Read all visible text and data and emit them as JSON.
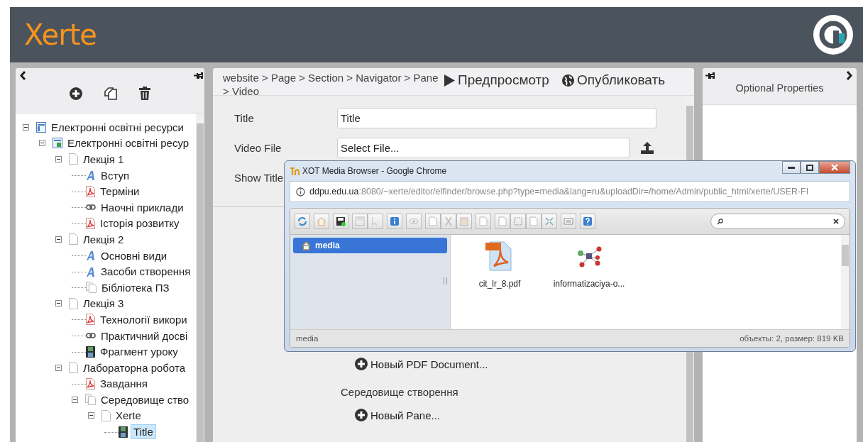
{
  "header": {
    "logo": "Xerte"
  },
  "tree_panel": {
    "tree": [
      {
        "label": "Електронні освітні ресурси",
        "kind": "root",
        "selected": false,
        "children": [
          {
            "label": "Електронні освітні ресур",
            "kind": "site",
            "selected": false,
            "children": [
              {
                "label": "Лекція 1",
                "kind": "page",
                "selected": false,
                "children": [
                  {
                    "label": "Вступ",
                    "kind": "text",
                    "selected": false
                  },
                  {
                    "label": "Терміни",
                    "kind": "pdf",
                    "selected": false
                  },
                  {
                    "label": "Наочні приклади",
                    "kind": "link",
                    "selected": false
                  },
                  {
                    "label": "Історія розвитку",
                    "kind": "pdf",
                    "selected": false
                  }
                ]
              },
              {
                "label": "Лекція 2",
                "kind": "page",
                "selected": false,
                "children": [
                  {
                    "label": "Основні види",
                    "kind": "text",
                    "selected": false
                  },
                  {
                    "label": "Засоби створення",
                    "kind": "text",
                    "selected": false
                  },
                  {
                    "label": "Бібліотека ПЗ",
                    "kind": "group",
                    "selected": false
                  }
                ]
              },
              {
                "label": "Лекція 3",
                "kind": "page",
                "selected": false,
                "children": [
                  {
                    "label": "Технології викори",
                    "kind": "pdf",
                    "selected": false
                  },
                  {
                    "label": "Практичний досві",
                    "kind": "link",
                    "selected": false
                  },
                  {
                    "label": "Фрагмент уроку",
                    "kind": "video",
                    "selected": false
                  }
                ]
              },
              {
                "label": "Лабораторна робота",
                "kind": "page",
                "selected": false,
                "children": [
                  {
                    "label": "Завдання",
                    "kind": "pdf",
                    "selected": false
                  },
                  {
                    "label": "Середовище ство",
                    "kind": "group",
                    "selected": false,
                    "children": [
                      {
                        "label": "Xerte",
                        "kind": "page",
                        "selected": false,
                        "children": [
                          {
                            "label": "Title",
                            "kind": "video",
                            "selected": true
                          }
                        ]
                      }
                    ]
                  }
                ]
              }
            ]
          }
        ]
      }
    ]
  },
  "editor": {
    "breadcrumb": "website > Page > Section > Navigator > Pane > Video",
    "actions": [
      {
        "kind": "play",
        "label": "Предпросмотр"
      },
      {
        "kind": "globe",
        "label": "Опубликовать"
      }
    ],
    "fields": [
      {
        "label": "Title",
        "kind": "text",
        "value": "Title"
      },
      {
        "label": "Video File",
        "kind": "file",
        "value": "Select File..."
      },
      {
        "label": "Show Title",
        "kind": "hidden"
      }
    ],
    "sections": [
      {
        "button": "Новый PDF Document..."
      },
      {
        "heading": "Середовище створення",
        "button": "Новый Pane..."
      }
    ]
  },
  "properties_panel": {
    "title": "Optional Properties"
  },
  "media_window": {
    "title": "XOT Media Browser - Google Chrome",
    "url_host": "ddpu.edu.ua",
    "url_rest": ":8080/~xerte/editor/elfinder/browse.php?type=media&lang=ru&uploadDir=/home/Admin/public_html/xerte/USER-FI",
    "folders": [
      {
        "label": "media",
        "selected": true
      }
    ],
    "files": [
      {
        "name": "cit_lr_8.pdf",
        "kind": "pdf"
      },
      {
        "name": "informatizaciya-o...",
        "kind": "image"
      }
    ],
    "status": {
      "path": "media",
      "info": "объекты: 2, размер: 819 KB"
    }
  }
}
